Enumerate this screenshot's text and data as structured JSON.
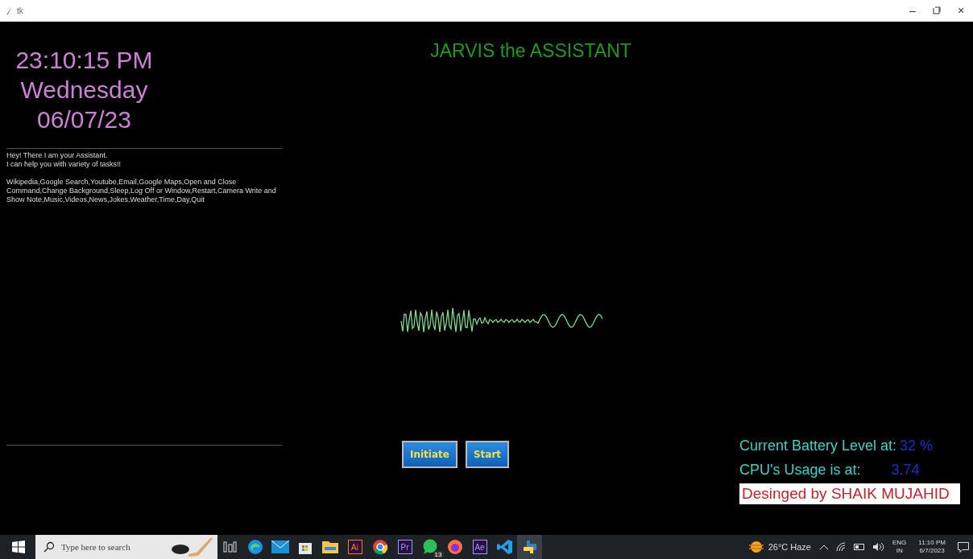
{
  "window": {
    "title": "tk",
    "controls": {
      "minimize": "–",
      "close": "×"
    }
  },
  "clock": {
    "time": "23:10:15 PM",
    "day": "Wednesday",
    "date": "06/07/23"
  },
  "intro": [
    "Hey! There I am your Assistant.",
    "I can help you with variety of tasks!!"
  ],
  "features": "Wikipedia,Google Search,Youtube,Email,Google Maps,Open and Close Command,Change Background,Sleep,Log Off or Window,Restart,Camera Write and Show Note,Music,Videos,News,Jokes,Weather,Time,Day,Quit",
  "heading": "JARVIS the ASSISTANT",
  "buttons": [
    "Initiate",
    "Start"
  ],
  "status": {
    "battery_label": "Current Battery Level at:",
    "battery_value": "32 %",
    "cpu_label": "CPU's Usage is at:",
    "cpu_value": "3.74",
    "credit": "Desinged by SHAIK MUJAHID"
  },
  "taskbar": {
    "search_placeholder": "Type here to search",
    "apps": [
      {
        "kind": "taskview",
        "active": false
      },
      {
        "kind": "edge",
        "active": false
      },
      {
        "kind": "mail",
        "active": false
      },
      {
        "kind": "store",
        "active": false
      },
      {
        "kind": "folder",
        "active": false
      },
      {
        "kind": "tile",
        "label": "Ai",
        "color": "#ff7c00",
        "active": false
      },
      {
        "kind": "chrome",
        "active": false
      },
      {
        "kind": "tile",
        "label": "Pr",
        "color": "#9999ff",
        "active": false
      },
      {
        "kind": "chat",
        "badge": "13",
        "active": false
      },
      {
        "kind": "firefox",
        "active": false
      },
      {
        "kind": "tile",
        "label": "Ae",
        "color": "#9999ff",
        "active": false
      },
      {
        "kind": "vscode",
        "active": false
      },
      {
        "kind": "python",
        "active": true
      }
    ],
    "weather": "26°C Haze",
    "lang": "ENG",
    "region": "IN",
    "time": "11:10 PM",
    "date": "6/7/2023"
  }
}
